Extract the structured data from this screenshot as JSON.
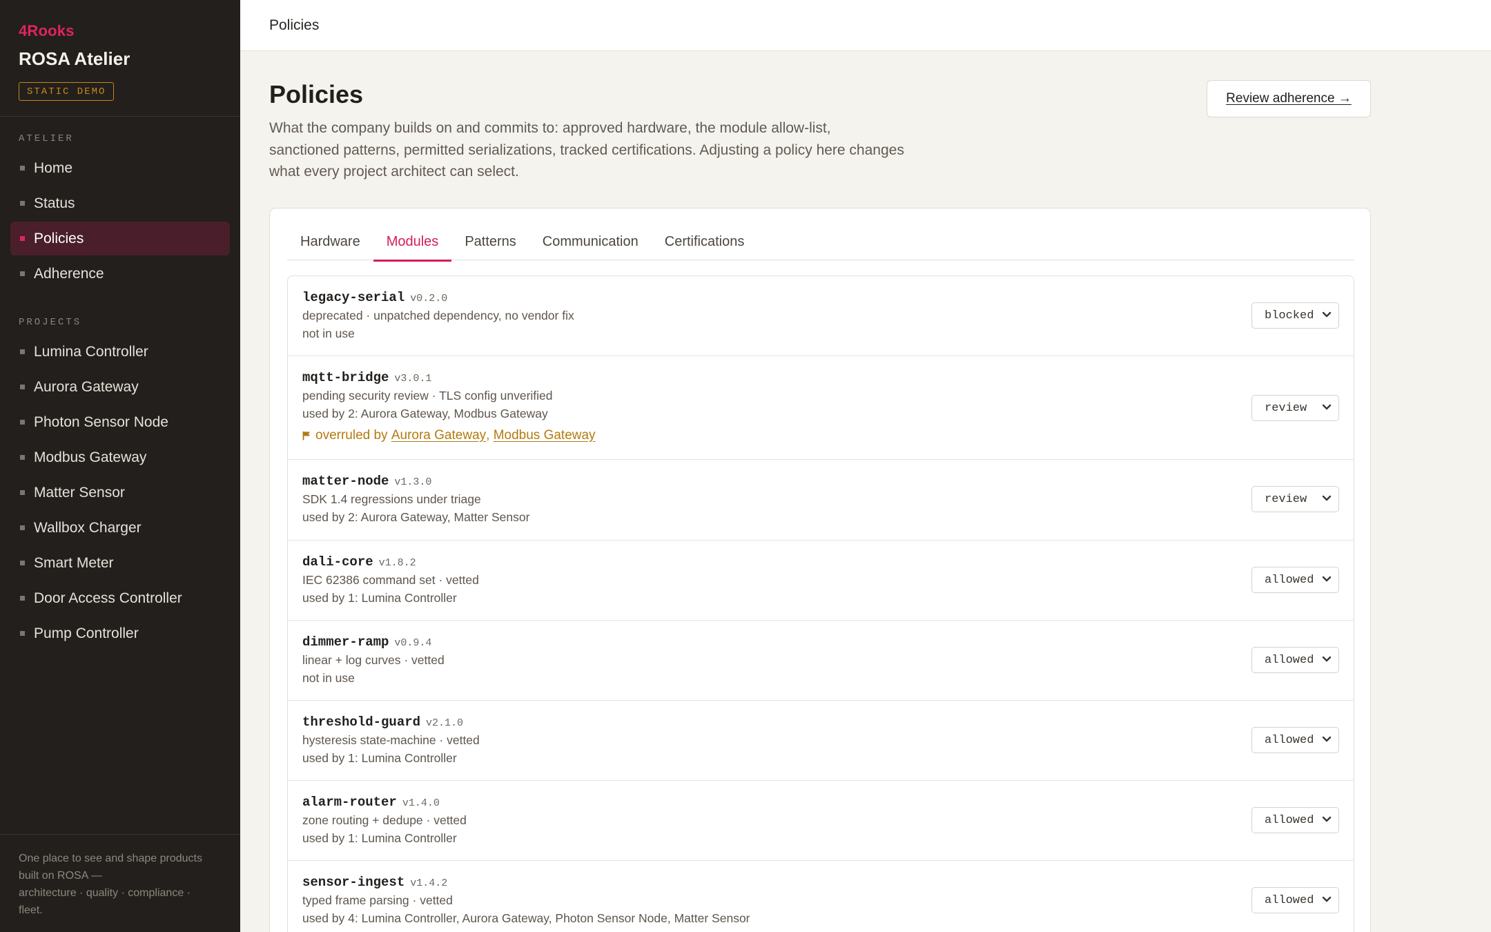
{
  "sidebar": {
    "brand": "4Rooks",
    "app_title": "ROSA Atelier",
    "badge": "STATIC DEMO",
    "atelier_label": "ATELIER",
    "atelier_items": [
      {
        "label": "Home",
        "active": false
      },
      {
        "label": "Status",
        "active": false
      },
      {
        "label": "Policies",
        "active": true
      },
      {
        "label": "Adherence",
        "active": false
      }
    ],
    "projects_label": "PROJECTS",
    "project_items": [
      {
        "label": "Lumina Controller"
      },
      {
        "label": "Aurora Gateway"
      },
      {
        "label": "Photon Sensor Node"
      },
      {
        "label": "Modbus Gateway"
      },
      {
        "label": "Matter Sensor"
      },
      {
        "label": "Wallbox Charger"
      },
      {
        "label": "Smart Meter"
      },
      {
        "label": "Door Access Controller"
      },
      {
        "label": "Pump Controller"
      }
    ],
    "footer_lines": [
      "One place to see and shape products",
      "built on ROSA —",
      "architecture · quality · compliance ·",
      "fleet."
    ]
  },
  "topbar": {
    "title": "Policies"
  },
  "page": {
    "title": "Policies",
    "description": "What the company builds on and commits to: approved hardware, the module allow-list, sanctioned patterns, permitted serializations, tracked certifications. Adjusting a policy here changes what every project architect can select.",
    "review_button": "Review adherence →"
  },
  "tabs": [
    {
      "label": "Hardware",
      "active": false
    },
    {
      "label": "Modules",
      "active": true
    },
    {
      "label": "Patterns",
      "active": false
    },
    {
      "label": "Communication",
      "active": false
    },
    {
      "label": "Certifications",
      "active": false
    }
  ],
  "modules": [
    {
      "name": "legacy-serial",
      "version": "v0.2.0",
      "description": "deprecated · unpatched dependency, no vendor fix",
      "usage": "not in use",
      "status": "blocked"
    },
    {
      "name": "mqtt-bridge",
      "version": "v3.0.1",
      "description": "pending security review · TLS config unverified",
      "usage": "used by 2: Aurora Gateway, Modbus Gateway",
      "status": "review",
      "override": {
        "prefix": "overruled by",
        "links": [
          "Aurora Gateway",
          "Modbus Gateway"
        ],
        "separator": ","
      }
    },
    {
      "name": "matter-node",
      "version": "v1.3.0",
      "description": "SDK 1.4 regressions under triage",
      "usage": "used by 2: Aurora Gateway, Matter Sensor",
      "status": "review"
    },
    {
      "name": "dali-core",
      "version": "v1.8.2",
      "description": "IEC 62386 command set · vetted",
      "usage": "used by 1: Lumina Controller",
      "status": "allowed"
    },
    {
      "name": "dimmer-ramp",
      "version": "v0.9.4",
      "description": "linear + log curves · vetted",
      "usage": "not in use",
      "status": "allowed"
    },
    {
      "name": "threshold-guard",
      "version": "v2.1.0",
      "description": "hysteresis state-machine · vetted",
      "usage": "used by 1: Lumina Controller",
      "status": "allowed"
    },
    {
      "name": "alarm-router",
      "version": "v1.4.0",
      "description": "zone routing + dedupe · vetted",
      "usage": "used by 1: Lumina Controller",
      "status": "allowed"
    },
    {
      "name": "sensor-ingest",
      "version": "v1.4.2",
      "description": "typed frame parsing · vetted",
      "usage": "used by 4: Lumina Controller, Aurora Gateway, Photon Sensor Node, Matter Sensor",
      "status": "allowed"
    }
  ],
  "colors": {
    "accent": "#e0245e",
    "warning": "#b37a10",
    "sidebar_bg": "#221f1c",
    "page_bg": "#f5f3ee"
  }
}
